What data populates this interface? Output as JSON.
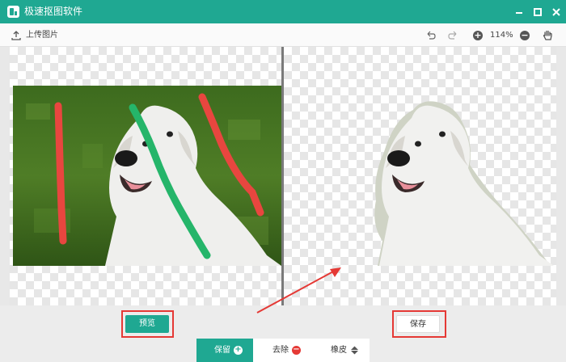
{
  "window": {
    "title": "极速抠图软件",
    "accent": "#1fa892"
  },
  "toolbar": {
    "upload_label": "上传图片",
    "zoom": "114%"
  },
  "actions": {
    "preview_label": "预览",
    "save_label": "保存"
  },
  "modes": [
    {
      "label": "保留",
      "icon": "plus-circle-icon",
      "active": true
    },
    {
      "label": "去除",
      "icon": "minus-circle-icon",
      "active": false
    },
    {
      "label": "橡皮",
      "icon": "eraser-icon",
      "active": false
    }
  ],
  "annotation_color": "#e53935"
}
